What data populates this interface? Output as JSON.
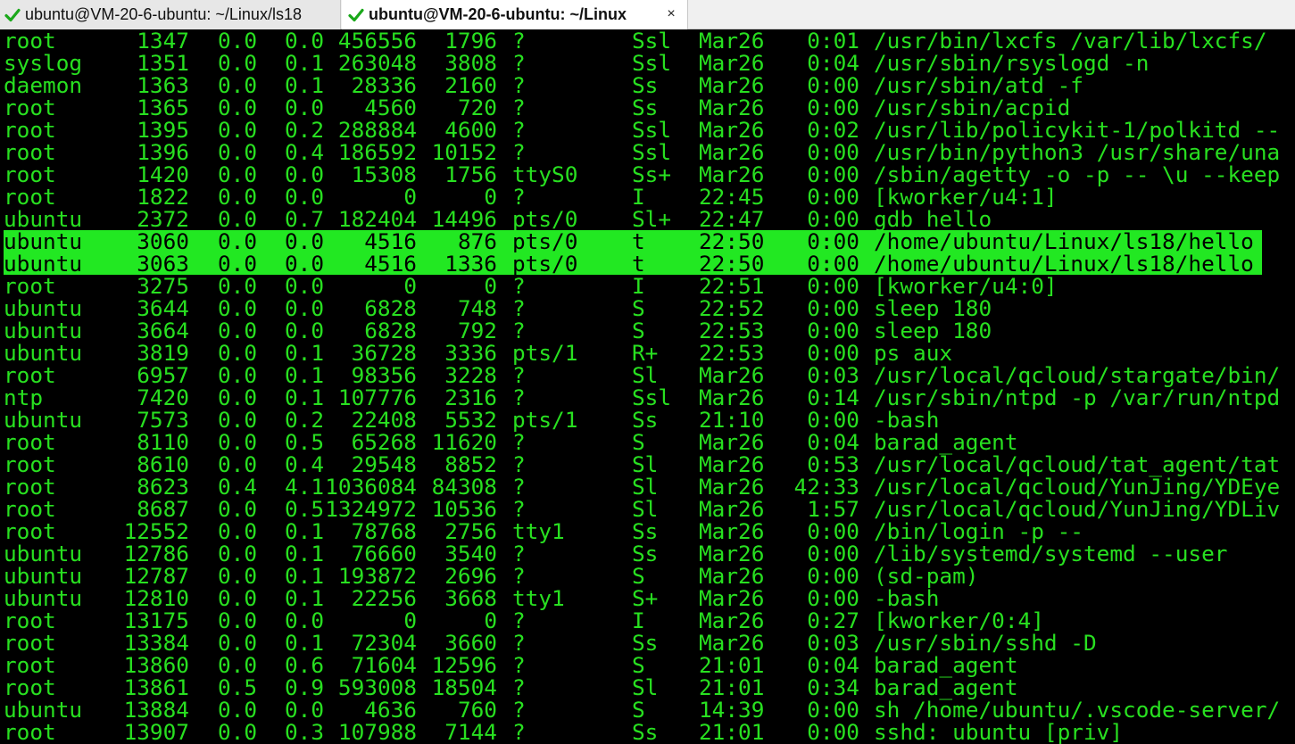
{
  "tabs": [
    {
      "label": "ubuntu@VM-20-6-ubuntu: ~/Linux/ls18",
      "active": false,
      "status_icon": "check-icon",
      "status_color": "#1aa81a"
    },
    {
      "label": "ubuntu@VM-20-6-ubuntu: ~/Linux",
      "active": true,
      "status_icon": "check-icon",
      "status_color": "#1aa81a",
      "close_label": "×"
    }
  ],
  "colors": {
    "text": "#28e020",
    "background": "#000000",
    "highlight": "#22e822",
    "highlight_text": "#000000"
  },
  "processes": [
    {
      "user": "root",
      "pid": "1347",
      "cpu": "0.0",
      "mem": "0.0",
      "vsz": "456556",
      "rss": "1796",
      "tty": "?",
      "stat": "Ssl",
      "start": "Mar26",
      "time": "0:01",
      "command": "/usr/bin/lxcfs /var/lib/lxcfs/",
      "highlighted": false
    },
    {
      "user": "syslog",
      "pid": "1351",
      "cpu": "0.0",
      "mem": "0.1",
      "vsz": "263048",
      "rss": "3808",
      "tty": "?",
      "stat": "Ssl",
      "start": "Mar26",
      "time": "0:04",
      "command": "/usr/sbin/rsyslogd -n",
      "highlighted": false
    },
    {
      "user": "daemon",
      "pid": "1363",
      "cpu": "0.0",
      "mem": "0.1",
      "vsz": "28336",
      "rss": "2160",
      "tty": "?",
      "stat": "Ss",
      "start": "Mar26",
      "time": "0:00",
      "command": "/usr/sbin/atd -f",
      "highlighted": false
    },
    {
      "user": "root",
      "pid": "1365",
      "cpu": "0.0",
      "mem": "0.0",
      "vsz": "4560",
      "rss": "720",
      "tty": "?",
      "stat": "Ss",
      "start": "Mar26",
      "time": "0:00",
      "command": "/usr/sbin/acpid",
      "highlighted": false
    },
    {
      "user": "root",
      "pid": "1395",
      "cpu": "0.0",
      "mem": "0.2",
      "vsz": "288884",
      "rss": "4600",
      "tty": "?",
      "stat": "Ssl",
      "start": "Mar26",
      "time": "0:02",
      "command": "/usr/lib/policykit-1/polkitd --",
      "highlighted": false
    },
    {
      "user": "root",
      "pid": "1396",
      "cpu": "0.0",
      "mem": "0.4",
      "vsz": "186592",
      "rss": "10152",
      "tty": "?",
      "stat": "Ssl",
      "start": "Mar26",
      "time": "0:00",
      "command": "/usr/bin/python3 /usr/share/una",
      "highlighted": false
    },
    {
      "user": "root",
      "pid": "1420",
      "cpu": "0.0",
      "mem": "0.0",
      "vsz": "15308",
      "rss": "1756",
      "tty": "ttyS0",
      "stat": "Ss+",
      "start": "Mar26",
      "time": "0:00",
      "command": "/sbin/agetty -o -p -- \\u --keep",
      "highlighted": false
    },
    {
      "user": "root",
      "pid": "1822",
      "cpu": "0.0",
      "mem": "0.0",
      "vsz": "0",
      "rss": "0",
      "tty": "?",
      "stat": "I",
      "start": "22:45",
      "time": "0:00",
      "command": "[kworker/u4:1]",
      "highlighted": false
    },
    {
      "user": "ubuntu",
      "pid": "2372",
      "cpu": "0.0",
      "mem": "0.7",
      "vsz": "182404",
      "rss": "14496",
      "tty": "pts/0",
      "stat": "Sl+",
      "start": "22:47",
      "time": "0:00",
      "command": "gdb hello",
      "highlighted": false
    },
    {
      "user": "ubuntu",
      "pid": "3060",
      "cpu": "0.0",
      "mem": "0.0",
      "vsz": "4516",
      "rss": "876",
      "tty": "pts/0",
      "stat": "t",
      "start": "22:50",
      "time": "0:00",
      "command": "/home/ubuntu/Linux/ls18/hello",
      "highlighted": true
    },
    {
      "user": "ubuntu",
      "pid": "3063",
      "cpu": "0.0",
      "mem": "0.0",
      "vsz": "4516",
      "rss": "1336",
      "tty": "pts/0",
      "stat": "t",
      "start": "22:50",
      "time": "0:00",
      "command": "/home/ubuntu/Linux/ls18/hello",
      "highlighted": true
    },
    {
      "user": "root",
      "pid": "3275",
      "cpu": "0.0",
      "mem": "0.0",
      "vsz": "0",
      "rss": "0",
      "tty": "?",
      "stat": "I",
      "start": "22:51",
      "time": "0:00",
      "command": "[kworker/u4:0]",
      "highlighted": false
    },
    {
      "user": "ubuntu",
      "pid": "3644",
      "cpu": "0.0",
      "mem": "0.0",
      "vsz": "6828",
      "rss": "748",
      "tty": "?",
      "stat": "S",
      "start": "22:52",
      "time": "0:00",
      "command": "sleep 180",
      "highlighted": false
    },
    {
      "user": "ubuntu",
      "pid": "3664",
      "cpu": "0.0",
      "mem": "0.0",
      "vsz": "6828",
      "rss": "792",
      "tty": "?",
      "stat": "S",
      "start": "22:53",
      "time": "0:00",
      "command": "sleep 180",
      "highlighted": false
    },
    {
      "user": "ubuntu",
      "pid": "3819",
      "cpu": "0.0",
      "mem": "0.1",
      "vsz": "36728",
      "rss": "3336",
      "tty": "pts/1",
      "stat": "R+",
      "start": "22:53",
      "time": "0:00",
      "command": "ps aux",
      "highlighted": false
    },
    {
      "user": "root",
      "pid": "6957",
      "cpu": "0.0",
      "mem": "0.1",
      "vsz": "98356",
      "rss": "3228",
      "tty": "?",
      "stat": "Sl",
      "start": "Mar26",
      "time": "0:03",
      "command": "/usr/local/qcloud/stargate/bin/",
      "highlighted": false
    },
    {
      "user": "ntp",
      "pid": "7420",
      "cpu": "0.0",
      "mem": "0.1",
      "vsz": "107776",
      "rss": "2316",
      "tty": "?",
      "stat": "Ssl",
      "start": "Mar26",
      "time": "0:14",
      "command": "/usr/sbin/ntpd -p /var/run/ntpd",
      "highlighted": false
    },
    {
      "user": "ubuntu",
      "pid": "7573",
      "cpu": "0.0",
      "mem": "0.2",
      "vsz": "22408",
      "rss": "5532",
      "tty": "pts/1",
      "stat": "Ss",
      "start": "21:10",
      "time": "0:00",
      "command": "-bash",
      "highlighted": false
    },
    {
      "user": "root",
      "pid": "8110",
      "cpu": "0.0",
      "mem": "0.5",
      "vsz": "65268",
      "rss": "11620",
      "tty": "?",
      "stat": "S",
      "start": "Mar26",
      "time": "0:04",
      "command": "barad_agent",
      "highlighted": false
    },
    {
      "user": "root",
      "pid": "8610",
      "cpu": "0.0",
      "mem": "0.4",
      "vsz": "29548",
      "rss": "8852",
      "tty": "?",
      "stat": "Sl",
      "start": "Mar26",
      "time": "0:53",
      "command": "/usr/local/qcloud/tat_agent/tat",
      "highlighted": false
    },
    {
      "user": "root",
      "pid": "8623",
      "cpu": "0.4",
      "mem": "4.1",
      "vsz": "1036084",
      "rss": "84308",
      "tty": "?",
      "stat": "Sl",
      "start": "Mar26",
      "time": "42:33",
      "command": "/usr/local/qcloud/YunJing/YDEye",
      "highlighted": false
    },
    {
      "user": "root",
      "pid": "8687",
      "cpu": "0.0",
      "mem": "0.5",
      "vsz": "1324972",
      "rss": "10536",
      "tty": "?",
      "stat": "Sl",
      "start": "Mar26",
      "time": "1:57",
      "command": "/usr/local/qcloud/YunJing/YDLiv",
      "highlighted": false
    },
    {
      "user": "root",
      "pid": "12552",
      "cpu": "0.0",
      "mem": "0.1",
      "vsz": "78768",
      "rss": "2756",
      "tty": "tty1",
      "stat": "Ss",
      "start": "Mar26",
      "time": "0:00",
      "command": "/bin/login -p --",
      "highlighted": false
    },
    {
      "user": "ubuntu",
      "pid": "12786",
      "cpu": "0.0",
      "mem": "0.1",
      "vsz": "76660",
      "rss": "3540",
      "tty": "?",
      "stat": "Ss",
      "start": "Mar26",
      "time": "0:00",
      "command": "/lib/systemd/systemd --user",
      "highlighted": false
    },
    {
      "user": "ubuntu",
      "pid": "12787",
      "cpu": "0.0",
      "mem": "0.1",
      "vsz": "193872",
      "rss": "2696",
      "tty": "?",
      "stat": "S",
      "start": "Mar26",
      "time": "0:00",
      "command": "(sd-pam)",
      "highlighted": false
    },
    {
      "user": "ubuntu",
      "pid": "12810",
      "cpu": "0.0",
      "mem": "0.1",
      "vsz": "22256",
      "rss": "3668",
      "tty": "tty1",
      "stat": "S+",
      "start": "Mar26",
      "time": "0:00",
      "command": "-bash",
      "highlighted": false
    },
    {
      "user": "root",
      "pid": "13175",
      "cpu": "0.0",
      "mem": "0.0",
      "vsz": "0",
      "rss": "0",
      "tty": "?",
      "stat": "I",
      "start": "Mar26",
      "time": "0:27",
      "command": "[kworker/0:4]",
      "highlighted": false
    },
    {
      "user": "root",
      "pid": "13384",
      "cpu": "0.0",
      "mem": "0.1",
      "vsz": "72304",
      "rss": "3660",
      "tty": "?",
      "stat": "Ss",
      "start": "Mar26",
      "time": "0:03",
      "command": "/usr/sbin/sshd -D",
      "highlighted": false
    },
    {
      "user": "root",
      "pid": "13860",
      "cpu": "0.0",
      "mem": "0.6",
      "vsz": "71604",
      "rss": "12596",
      "tty": "?",
      "stat": "S",
      "start": "21:01",
      "time": "0:04",
      "command": "barad_agent",
      "highlighted": false
    },
    {
      "user": "root",
      "pid": "13861",
      "cpu": "0.5",
      "mem": "0.9",
      "vsz": "593008",
      "rss": "18504",
      "tty": "?",
      "stat": "Sl",
      "start": "21:01",
      "time": "0:34",
      "command": "barad_agent",
      "highlighted": false
    },
    {
      "user": "ubuntu",
      "pid": "13884",
      "cpu": "0.0",
      "mem": "0.0",
      "vsz": "4636",
      "rss": "760",
      "tty": "?",
      "stat": "S",
      "start": "14:39",
      "time": "0:00",
      "command": "sh /home/ubuntu/.vscode-server/",
      "highlighted": false
    },
    {
      "user": "root",
      "pid": "13907",
      "cpu": "0.0",
      "mem": "0.3",
      "vsz": "107988",
      "rss": "7144",
      "tty": "?",
      "stat": "Ss",
      "start": "21:01",
      "time": "0:00",
      "command": "sshd: ubuntu [priv]",
      "highlighted": false
    }
  ]
}
